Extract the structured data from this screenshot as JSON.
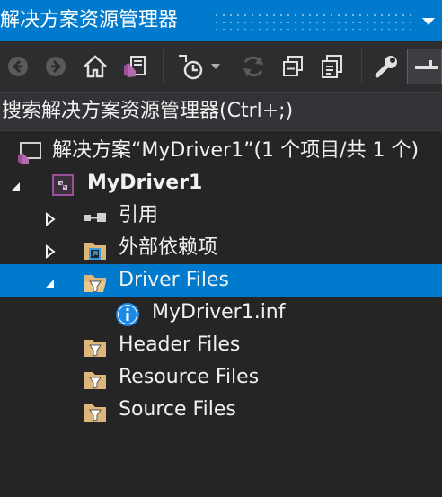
{
  "window": {
    "title": "解决方案资源管理器"
  },
  "search": {
    "placeholder": "搜索解决方案资源管理器(Ctrl+;)"
  },
  "tree": {
    "solution": "解决方案“MyDriver1”(1 个项目/共 1 个)",
    "project": "MyDriver1",
    "references": "引用",
    "external_deps": "外部依赖项",
    "driver_files": "Driver Files",
    "inf_file": "MyDriver1.inf",
    "header_files": "Header Files",
    "resource_files": "Resource Files",
    "source_files": "Source Files"
  },
  "colors": {
    "accent": "#007acc",
    "background": "#252526",
    "toolbar": "#2d2d30",
    "folder": "#dcb67a",
    "project_icon": "#9b4f96"
  },
  "icons": [
    "back-icon",
    "forward-icon",
    "home-icon",
    "switch-views-icon",
    "pending-changes-filter-icon",
    "dropdown-icon",
    "refresh-icon",
    "collapse-all-icon",
    "show-all-files-icon",
    "properties-wrench-icon",
    "preview-icon"
  ]
}
